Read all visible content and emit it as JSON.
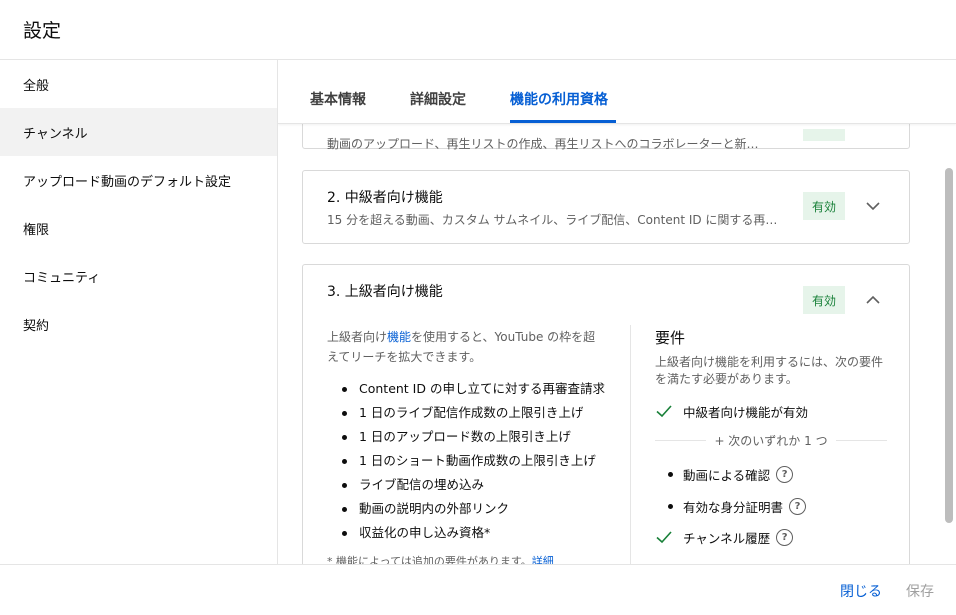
{
  "header": {
    "title": "設定"
  },
  "sidebar": {
    "items": [
      {
        "label": "全般"
      },
      {
        "label": "チャンネル"
      },
      {
        "label": "アップロード動画のデフォルト設定"
      },
      {
        "label": "権限"
      },
      {
        "label": "コミュニティ"
      },
      {
        "label": "契約"
      }
    ],
    "active_index": 1
  },
  "tabs": [
    {
      "label": "基本情報"
    },
    {
      "label": "詳細設定"
    },
    {
      "label": "機能の利用資格"
    }
  ],
  "features": {
    "card1": {
      "desc": "動画のアップロード、再生リストの作成、再生リストへのコラボレーターと新…"
    },
    "card2": {
      "title": "2. 中級者向け機能",
      "desc": "15 分を超える動画、カスタム サムネイル、ライブ配信、Content ID に関する再…",
      "status": "有効"
    },
    "card3": {
      "title": "3. 上級者向け機能",
      "status": "有効",
      "intro_before": "上級者向け",
      "intro_link": "機能",
      "intro_after": "を使用すると、YouTube の枠を超えてリーチを拡大できます。",
      "items": [
        "Content ID の申し立てに対する再審査請求",
        "1 日のライブ配信作成数の上限引き上げ",
        "1 日のアップロード数の上限引き上げ",
        "1 日のショート動画作成数の上限引き上げ",
        "ライブ配信の埋め込み",
        "動画の説明内の外部リンク",
        "収益化の申し込み資格*"
      ],
      "note_text": "* 機能によっては追加の要件があります。",
      "note_link": "詳細",
      "requirements": {
        "title": "要件",
        "desc": "上級者向け機能を利用するには、次の要件を満たす必要があります。",
        "met": "中級者向け機能が有効",
        "or_label": "+ 次のいずれか 1 つ",
        "options": [
          "動画による確認",
          "有効な身分証明書"
        ],
        "history": "チャンネル履歴",
        "help_symbol": "?"
      }
    }
  },
  "footer": {
    "close_label": "閉じる",
    "save_label": "保存"
  },
  "colors": {
    "accent": "#065fd4",
    "enabled_bg": "#e6f4ea",
    "enabled_text": "#188038",
    "check": "#188038"
  }
}
